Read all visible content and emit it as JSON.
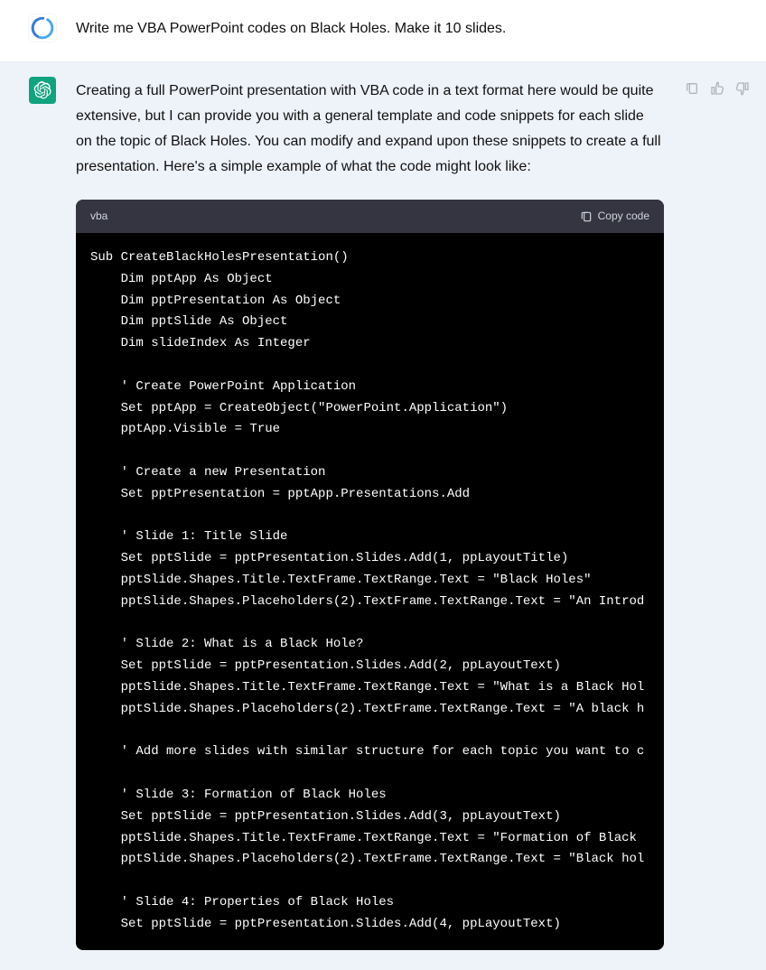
{
  "user": {
    "prompt": "Write me VBA PowerPoint codes on Black Holes. Make it 10 slides."
  },
  "assistant": {
    "intro": "Creating a full PowerPoint presentation with VBA code in a text format here would be quite extensive, but I can provide you with a general template and code snippets for each slide on the topic of Black Holes. You can modify and expand upon these snippets to create a full presentation. Here's a simple example of what the code might look like:"
  },
  "code": {
    "language": "vba",
    "copy_label": "Copy code",
    "content": "Sub CreateBlackHolesPresentation()\n    Dim pptApp As Object\n    Dim pptPresentation As Object\n    Dim pptSlide As Object\n    Dim slideIndex As Integer\n\n    ' Create PowerPoint Application\n    Set pptApp = CreateObject(\"PowerPoint.Application\")\n    pptApp.Visible = True\n\n    ' Create a new Presentation\n    Set pptPresentation = pptApp.Presentations.Add\n\n    ' Slide 1: Title Slide\n    Set pptSlide = pptPresentation.Slides.Add(1, ppLayoutTitle)\n    pptSlide.Shapes.Title.TextFrame.TextRange.Text = \"Black Holes\"\n    pptSlide.Shapes.Placeholders(2).TextFrame.TextRange.Text = \"An Introd\n\n    ' Slide 2: What is a Black Hole?\n    Set pptSlide = pptPresentation.Slides.Add(2, ppLayoutText)\n    pptSlide.Shapes.Title.TextFrame.TextRange.Text = \"What is a Black Hol\n    pptSlide.Shapes.Placeholders(2).TextFrame.TextRange.Text = \"A black h\n\n    ' Add more slides with similar structure for each topic you want to c\n\n    ' Slide 3: Formation of Black Holes\n    Set pptSlide = pptPresentation.Slides.Add(3, ppLayoutText)\n    pptSlide.Shapes.Title.TextFrame.TextRange.Text = \"Formation of Black \n    pptSlide.Shapes.Placeholders(2).TextFrame.TextRange.Text = \"Black hol\n\n    ' Slide 4: Properties of Black Holes\n    Set pptSlide = pptPresentation.Slides.Add(4, ppLayoutText)"
  },
  "icons": {
    "clipboard": "clipboard-icon",
    "thumbs_up": "thumbs-up-icon",
    "thumbs_down": "thumbs-down-icon"
  }
}
